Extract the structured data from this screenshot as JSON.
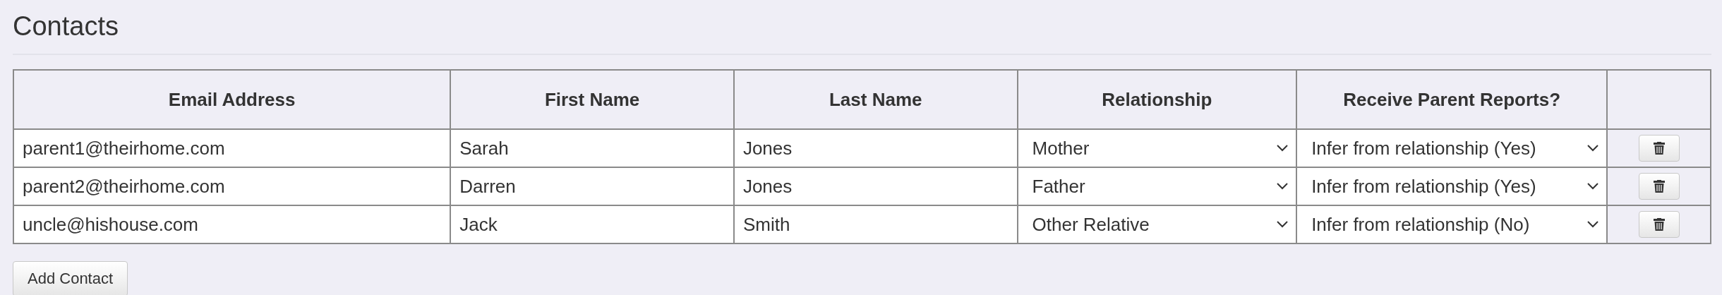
{
  "title": "Contacts",
  "table": {
    "columns": [
      "Email Address",
      "First Name",
      "Last Name",
      "Relationship",
      "Receive Parent Reports?"
    ],
    "rows": [
      {
        "email": "parent1@theirhome.com",
        "first_name": "Sarah",
        "last_name": "Jones",
        "relationship": "Mother",
        "reports": "Infer from relationship (Yes)"
      },
      {
        "email": "parent2@theirhome.com",
        "first_name": "Darren",
        "last_name": "Jones",
        "relationship": "Father",
        "reports": "Infer from relationship (Yes)"
      },
      {
        "email": "uncle@hishouse.com",
        "first_name": "Jack",
        "last_name": "Smith",
        "relationship": "Other Relative",
        "reports": "Infer from relationship (No)"
      }
    ]
  },
  "add_button": "Add Contact"
}
